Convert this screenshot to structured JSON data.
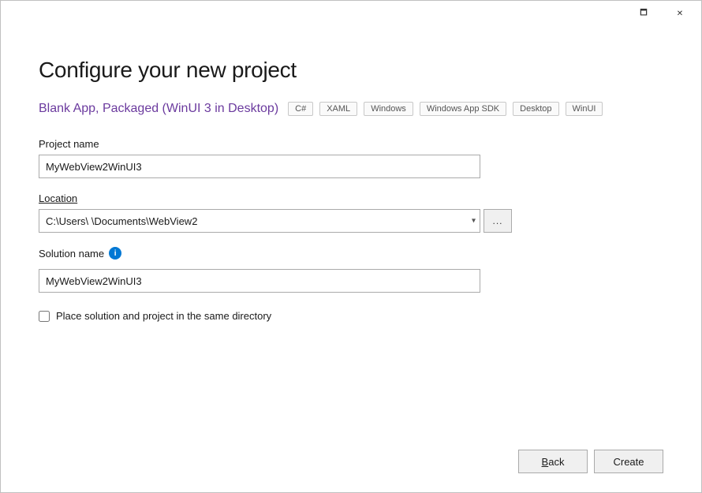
{
  "window": {
    "title_bar": {
      "restore_btn": "🗖",
      "close_btn": "✕"
    }
  },
  "page": {
    "title": "Configure your new project",
    "project_type": {
      "name": "Blank App, Packaged (WinUI 3 in Desktop)",
      "tags": [
        "C#",
        "XAML",
        "Windows",
        "Windows App SDK",
        "Desktop",
        "WinUI"
      ]
    },
    "form": {
      "project_name_label": "Project name",
      "project_name_value": "MyWebView2WinUI3",
      "location_label": "Location",
      "location_value": "C:\\Users\\        \\Documents\\WebView2",
      "browse_label": "...",
      "solution_name_label": "Solution name",
      "solution_name_info": "i",
      "solution_name_value": "MyWebView2WinUI3",
      "checkbox_label": "Place solution and project in the same directory"
    },
    "footer": {
      "back_label": "Back",
      "create_label": "Create"
    }
  }
}
